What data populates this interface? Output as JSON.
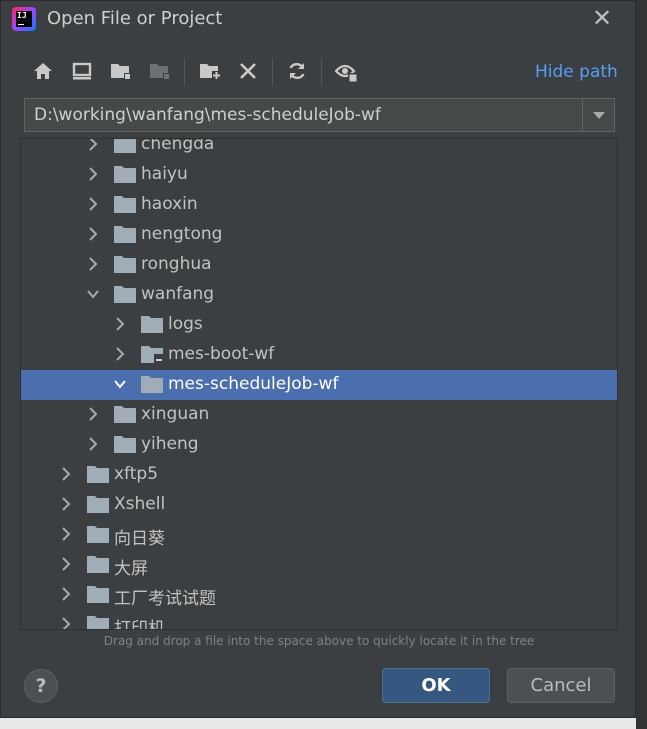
{
  "window": {
    "title": "Open File or Project",
    "close_glyph": "✕"
  },
  "toolbar": {
    "icons": [
      "home-icon",
      "desktop-icon",
      "project-folder-icon",
      "module-folder-icon",
      "new-folder-icon",
      "delete-icon",
      "refresh-icon",
      "show-hidden-icon"
    ],
    "hide_path_label": "Hide path"
  },
  "path": {
    "value": "D:\\working\\wanfang\\mes-scheduleJob-wf"
  },
  "tree": {
    "items": [
      {
        "label": "chengda",
        "expanded": false,
        "selected": false
      },
      {
        "label": "haiyu",
        "expanded": false,
        "selected": false
      },
      {
        "label": "haoxin",
        "expanded": false,
        "selected": false
      },
      {
        "label": "nengtong",
        "expanded": false,
        "selected": false
      },
      {
        "label": "ronghua",
        "expanded": false,
        "selected": false
      },
      {
        "label": "wanfang",
        "expanded": true,
        "selected": false
      },
      {
        "label": "logs",
        "expanded": false,
        "selected": false
      },
      {
        "label": "mes-boot-wf",
        "expanded": false,
        "selected": false
      },
      {
        "label": "mes-scheduleJob-wf",
        "expanded": true,
        "selected": true
      },
      {
        "label": "xinguan",
        "expanded": false,
        "selected": false
      },
      {
        "label": "yiheng",
        "expanded": false,
        "selected": false
      },
      {
        "label": "xftp5",
        "expanded": false,
        "selected": false
      },
      {
        "label": "Xshell",
        "expanded": false,
        "selected": false
      },
      {
        "label": "向日葵",
        "expanded": false,
        "selected": false
      },
      {
        "label": "大屏",
        "expanded": false,
        "selected": false
      },
      {
        "label": "工厂考试试题",
        "expanded": false,
        "selected": false
      },
      {
        "label": "打印机",
        "expanded": false,
        "selected": false
      }
    ]
  },
  "hint": "Drag and drop a file into the space above to quickly locate it in the tree",
  "buttons": {
    "help": "?",
    "ok": "OK",
    "cancel": "Cancel"
  },
  "colors": {
    "selection": "#4b6eaf",
    "link": "#589df6",
    "folder": "#a0adb7",
    "ok_button": "#365880",
    "background": "#3c3f41"
  }
}
